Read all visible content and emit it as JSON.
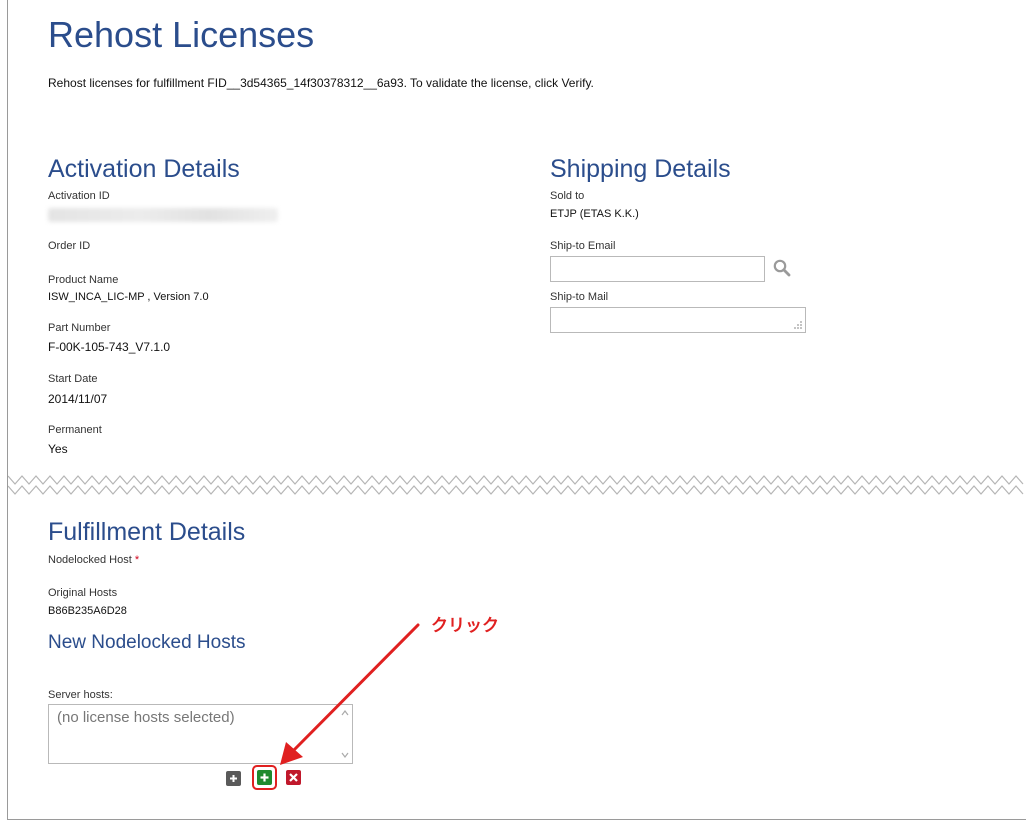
{
  "page": {
    "title": "Rehost Licenses",
    "intro": "Rehost licenses for fulfillment FID__3d54365_14f30378312__6a93.  To validate the license, click Verify."
  },
  "activation": {
    "heading": "Activation Details",
    "activation_id_label": "Activation ID",
    "order_id_label": "Order ID",
    "product_name_label": "Product Name",
    "product_name_value": "ISW_INCA_LIC-MP , Version 7.0",
    "part_number_label": "Part Number",
    "part_number_value": "F-00K-105-743_V7.1.0",
    "start_date_label": "Start Date",
    "start_date_value": "2014/11/07",
    "permanent_label": "Permanent",
    "permanent_value": "Yes"
  },
  "shipping": {
    "heading": "Shipping Details",
    "sold_to_label": "Sold to",
    "sold_to_value": "ETJP (ETAS K.K.)",
    "email_label": "Ship-to Email",
    "email_value": "",
    "mail_label": "Ship-to Mail",
    "mail_value": ""
  },
  "fulfillment": {
    "heading": "Fulfillment Details",
    "nodelocked_label": "Nodelocked Host",
    "required_mark": "*",
    "original_hosts_label": "Original Hosts",
    "original_hosts_value": "B86B235A6D28",
    "new_hosts_heading": "New Nodelocked Hosts",
    "server_hosts_label": "Server hosts:",
    "server_hosts_placeholder": "(no license hosts selected)"
  },
  "buttons": {
    "expand": "+",
    "add": "+",
    "remove": "✖"
  },
  "annotation": {
    "text": "クリック",
    "color": "#e02020"
  },
  "colors": {
    "heading": "#2b4d8c",
    "add_button": "#1f8a2e",
    "remove_button": "#c0182b"
  },
  "icons": {
    "search": "search-icon",
    "expand": "expand-icon",
    "add": "add-icon",
    "remove": "remove-icon"
  }
}
